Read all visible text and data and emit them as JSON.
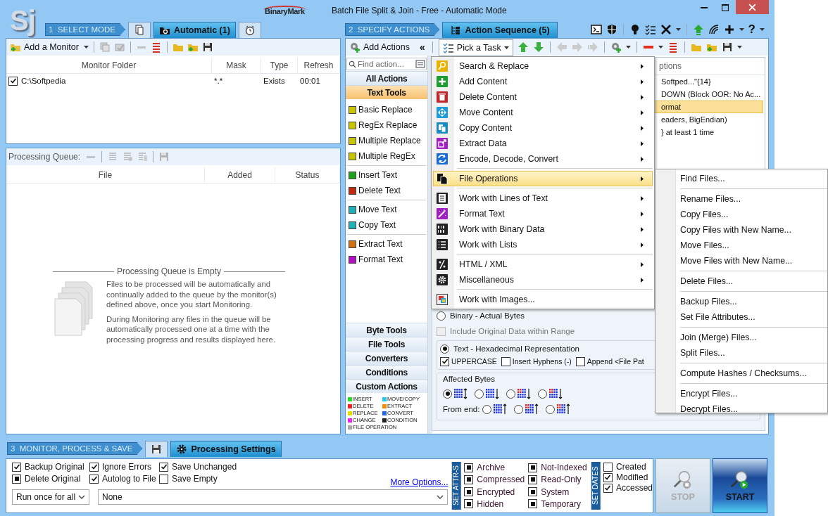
{
  "window": {
    "logo": "Sj",
    "brand": "BinaryMark",
    "title": "Batch File Split & Join - Free - Automatic Mode",
    "help": "?"
  },
  "mode_bar": {
    "step": "1  SELECT MODE",
    "tabs": [
      {
        "kind": "files",
        "selected": false
      },
      {
        "kind": "folder",
        "label": "Automatic (1)",
        "selected": true
      },
      {
        "kind": "alarm",
        "selected": false
      }
    ]
  },
  "actions_bar": {
    "step": "2  SPECIFY ACTIONS",
    "tabs": [
      {
        "kind": "sequence",
        "label": "Action Sequence (5)",
        "selected": true
      }
    ]
  },
  "monitor_panel": {
    "add_button": "Add a Monitor",
    "columns": [
      "Monitor Folder",
      "Mask",
      "Type",
      "Refresh"
    ],
    "rows": [
      {
        "checked": true,
        "cells": [
          "C:\\Softpedia",
          "*.*",
          "Exists",
          "00:01"
        ]
      }
    ]
  },
  "queue_panel": {
    "label": "Processing Queue:",
    "columns": [
      "File",
      "Added",
      "Status"
    ],
    "empty_title": "Processing Queue is Empty",
    "empty_text": [
      "Files to be processed will be automatically and continually added to the queue by the monitor(s) defined above, once you start Monitoring.",
      "During Monitoring any files in the queue will be automatically processed one at a time with the processing progress and results displayed here."
    ]
  },
  "actions_panel": {
    "add_button": "Add Actions",
    "collapse": "«",
    "task_button": "Pick a Task",
    "search": {
      "placeholder": "Find action..."
    },
    "categories_top": [
      {
        "label": "All Actions",
        "selected": false
      },
      {
        "label": "Text Tools",
        "selected": true
      }
    ],
    "tool_groups": [
      [
        {
          "label": "Basic Replace",
          "color": "#c8c400"
        },
        {
          "label": "RegEx Replace",
          "color": "#c8c400"
        },
        {
          "label": "Multiple Replace",
          "color": "#c8c400"
        },
        {
          "label": "Multiple RegEx",
          "color": "#c8c400"
        }
      ],
      [
        {
          "label": "Insert Text",
          "color": "#1fa01f"
        },
        {
          "label": "Delete Text",
          "color": "#c02a10"
        }
      ],
      [
        {
          "label": "Move Text",
          "color": "#20b0b8"
        },
        {
          "label": "Copy Text",
          "color": "#20b0b8"
        }
      ],
      [
        {
          "label": "Extract Text",
          "color": "#d07010"
        },
        {
          "label": "Format Text",
          "color": "#b010c0"
        }
      ]
    ],
    "categories_bottom": [
      {
        "label": "Byte Tools",
        "selected": false
      },
      {
        "label": "File Tools",
        "selected": false
      },
      {
        "label": "Converters",
        "selected": false
      },
      {
        "label": "Conditions",
        "selected": false
      },
      {
        "label": "Custom Actions",
        "selected": false
      }
    ],
    "legend": [
      {
        "label": "INSERT",
        "color": "#22dd22"
      },
      {
        "label": "MOVE/COPY",
        "color": "#22ccee"
      },
      {
        "label": "DELETE",
        "color": "#ee2222"
      },
      {
        "label": "EXTRACT",
        "color": "#ff8800"
      },
      {
        "label": "REPLACE",
        "color": "#e8dd00"
      },
      {
        "label": "CONVERT",
        "color": "#2266ee"
      },
      {
        "label": "CHANGE",
        "color": "#ee22ee"
      },
      {
        "label": "CONDITION",
        "color": "#222222"
      },
      {
        "label": "FILE OPERATION",
        "color": "#aaaaaa"
      }
    ]
  },
  "sequence": {
    "header": "ptions",
    "rows": [
      {
        "text": "Softped...\"{14}",
        "selected": false
      },
      {
        "text": "DOWN (Block OOR: No Ac...",
        "selected": false
      },
      {
        "text": "ormat",
        "selected": true
      },
      {
        "text": "eaders, BigEndian)",
        "selected": false
      },
      {
        "text": "} at least 1 time",
        "selected": false
      }
    ]
  },
  "settings": {
    "binary_radio": {
      "label": "Binary - Actual Bytes",
      "selected": false
    },
    "include_original": {
      "label": "Include Original Data within Range",
      "checked": false,
      "disabled": true
    },
    "text_radio": {
      "label": "Text - Hexadecimal Representation",
      "selected": true
    },
    "text_options": [
      {
        "label": "UPPERCASE",
        "checked": true
      },
      {
        "label": "Insert Hyphens (-)",
        "checked": false
      },
      {
        "label": "Append <File Pat",
        "checked": false
      }
    ],
    "affected_bytes": {
      "title": "Affected Bytes",
      "from_end": "From end:",
      "options": [
        {
          "selected": true,
          "kind": "both"
        },
        {
          "selected": false,
          "kind": "down"
        },
        {
          "selected": false,
          "kind": "red-down"
        },
        {
          "selected": false,
          "kind": "red-down"
        }
      ],
      "end_options": [
        {
          "selected": false,
          "kind": "up"
        },
        {
          "selected": false,
          "kind": "red-up"
        },
        {
          "selected": false,
          "kind": "red-up"
        }
      ]
    }
  },
  "task_menu": {
    "groups": [
      [
        {
          "label": "Search & Replace",
          "kind": "search",
          "submenu": true,
          "selected": false
        },
        {
          "label": "Add Content",
          "kind": "add",
          "submenu": true,
          "selected": false
        },
        {
          "label": "Delete Content",
          "kind": "delete",
          "submenu": true,
          "selected": false
        },
        {
          "label": "Move Content",
          "kind": "move",
          "submenu": true,
          "selected": false
        },
        {
          "label": "Copy Content",
          "kind": "copy",
          "submenu": true,
          "selected": false
        },
        {
          "label": "Extract Data",
          "kind": "extract",
          "submenu": true,
          "selected": false
        },
        {
          "label": "Encode, Decode, Convert",
          "kind": "encode",
          "submenu": true,
          "selected": false
        }
      ],
      [
        {
          "label": "File Operations",
          "kind": "files",
          "submenu": true,
          "selected": true
        }
      ],
      [
        {
          "label": "Work with Lines of Text",
          "kind": "lines",
          "submenu": true,
          "selected": false
        },
        {
          "label": "Format Text",
          "kind": "format",
          "submenu": true,
          "selected": false
        },
        {
          "label": "Work with Binary Data",
          "kind": "binary",
          "submenu": true,
          "selected": false
        },
        {
          "label": "Work with Lists",
          "kind": "list",
          "submenu": true,
          "selected": false
        }
      ],
      [
        {
          "label": "HTML / XML",
          "kind": "html",
          "submenu": true,
          "selected": false
        },
        {
          "label": "Miscellaneous",
          "kind": "misc",
          "submenu": true,
          "selected": false
        }
      ],
      [
        {
          "label": "Work with Images...",
          "kind": "images",
          "submenu": false,
          "selected": false
        }
      ]
    ]
  },
  "file_submenu": {
    "groups": [
      [
        "Find Files..."
      ],
      [
        "Rename Files...",
        "Copy Files...",
        "Copy Files with New Name...",
        "Move Files...",
        "Move Files with New Name..."
      ],
      [
        "Delete Files..."
      ],
      [
        "Backup Files...",
        "Set File Attributes..."
      ],
      [
        "Join (Merge) Files...",
        "Split Files..."
      ],
      [
        "Compute Hashes / Checksums..."
      ],
      [
        "Encrypt Files...",
        "Decrypt Files..."
      ]
    ]
  },
  "bottom": {
    "step": "3  MONITOR, PROCESS & SAVE",
    "tabs": [
      {
        "kind": "save",
        "selected": false
      },
      {
        "kind": "gear",
        "label": "Processing Settings",
        "selected": true
      }
    ],
    "options": [
      {
        "label": "Backup Original",
        "checked": true,
        "indeterminate": false
      },
      {
        "label": "Ignore Errors",
        "checked": true,
        "indeterminate": false
      },
      {
        "label": "Save Unchanged",
        "checked": true,
        "indeterminate": false
      },
      {
        "label": "Delete Original",
        "checked": true,
        "indeterminate": true
      },
      {
        "label": "Autolog to File",
        "checked": true,
        "indeterminate": false
      },
      {
        "label": "Save Empty",
        "checked": false,
        "indeterminate": false
      }
    ],
    "more_link": "More Options...",
    "run_select": "Run once for all",
    "command_select": "None",
    "attrs": {
      "title": "SET ATTR-S",
      "items": [
        {
          "label": "Archive",
          "checked": true,
          "indeterminate": true
        },
        {
          "label": "Not-Indexed",
          "checked": true,
          "indeterminate": true
        },
        {
          "label": "Compressed",
          "checked": true,
          "indeterminate": true
        },
        {
          "label": "Read-Only",
          "checked": true,
          "indeterminate": true
        },
        {
          "label": "Encrypted",
          "checked": true,
          "indeterminate": true
        },
        {
          "label": "System",
          "checked": true,
          "indeterminate": true
        },
        {
          "label": "Hidden",
          "checked": true,
          "indeterminate": true
        },
        {
          "label": "Temporary",
          "checked": true,
          "indeterminate": true
        }
      ]
    },
    "dates": {
      "title": "SET DATES",
      "items": [
        {
          "label": "Created",
          "checked": false,
          "indeterminate": false
        },
        {
          "label": "Modified",
          "checked": true,
          "indeterminate": false
        },
        {
          "label": "Accessed",
          "checked": true,
          "indeterminate": false
        }
      ]
    },
    "stop": {
      "label": "STOP",
      "disabled": true
    },
    "start": {
      "label": "START",
      "disabled": false
    }
  }
}
